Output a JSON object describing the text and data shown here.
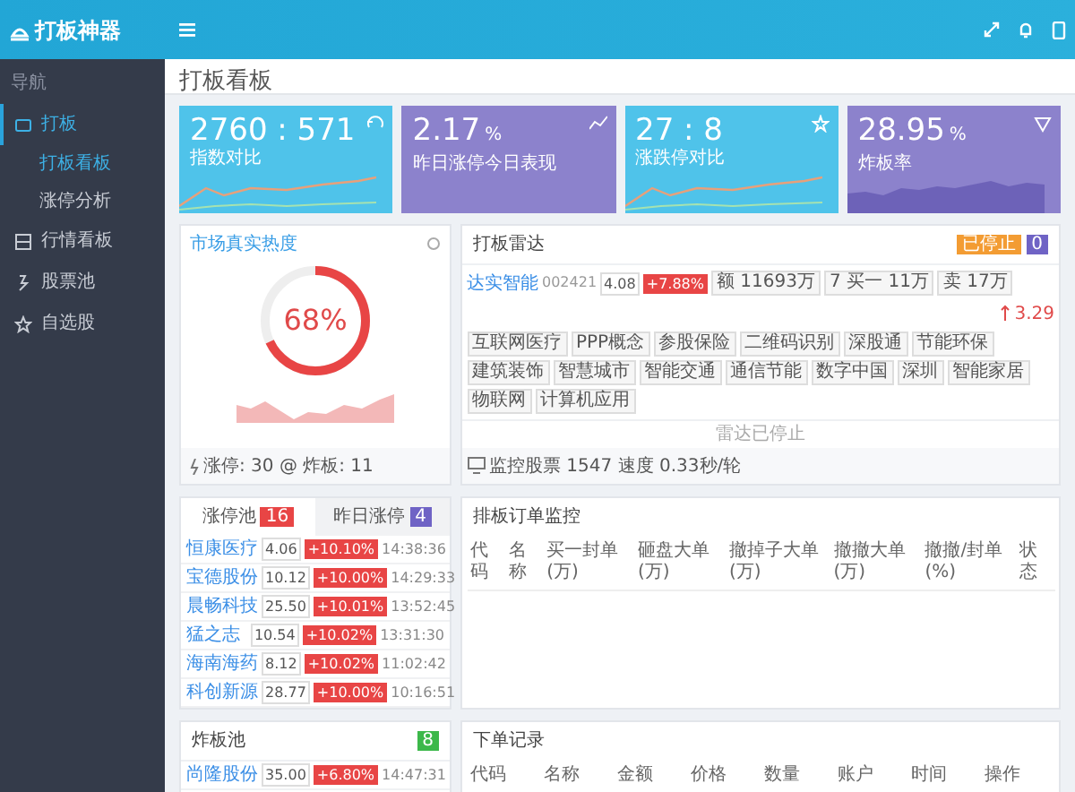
{
  "app": {
    "title": "打板神器"
  },
  "sidebar": {
    "heading": "导航",
    "items": [
      {
        "label": "打板",
        "selected": true,
        "children": [
          {
            "label": "打板看板",
            "selected": true
          },
          {
            "label": "涨停分析",
            "selected": false
          }
        ]
      },
      {
        "label": "行情看板",
        "selected": false
      },
      {
        "label": "股票池",
        "selected": false
      },
      {
        "label": "自选股",
        "selected": false
      }
    ]
  },
  "page_title": "打板看板",
  "stats": [
    {
      "value": "2760 : 571",
      "label": "指数对比",
      "color": "#4fc3ea",
      "kind": "line"
    },
    {
      "value": "2.17",
      "unit": "%",
      "label": "昨日涨停今日表现",
      "color": "#8c82cc",
      "kind": "flat"
    },
    {
      "value": "27 : 8",
      "label": "涨跌停对比",
      "color": "#4fc3ea",
      "kind": "line"
    },
    {
      "value": "28.95",
      "unit": "%",
      "label": "炸板率",
      "color": "#8c82cc",
      "kind": "area"
    }
  ],
  "heat": {
    "title": "市场真实热度",
    "reading": "68%",
    "level": 0.68,
    "footer": "涨停: 30 @ 炸板: 11"
  },
  "radar": {
    "title": "打板雷达",
    "badges": [
      {
        "text": "已停止",
        "color": "#f39c33"
      },
      {
        "text": "0",
        "color": "#6f63c5"
      }
    ],
    "stock": {
      "name": "达实智能",
      "code": "002421",
      "price": "4.08",
      "change": "+7.88%",
      "amount": "额 11693万",
      "buy": "7 买一 11万",
      "sell": "卖 17万",
      "score": "3.29"
    },
    "tags": [
      "互联网医疗",
      "PPP概念",
      "参股保险",
      "二维码识别",
      "深股通",
      "节能环保",
      "建筑装饰",
      "智慧城市",
      "智能交通",
      "通信节能",
      "数字中国",
      "深圳",
      "智能家居",
      "物联网",
      "计算机应用"
    ],
    "message": "雷达已停止",
    "footer": "监控股票 1547  速度 0.33秒/轮"
  },
  "pool": {
    "tabs": [
      {
        "label": "涨停池",
        "count": "16",
        "color": "#e84545",
        "selected": true
      },
      {
        "label": "昨日涨停",
        "count": "4",
        "color": "#6f63c5",
        "selected": false
      }
    ],
    "rows": [
      {
        "name": "恒康医疗",
        "price": "4.06",
        "change": "+10.10%",
        "time": "14:38:36"
      },
      {
        "name": "宝德股份",
        "price": "10.12",
        "change": "+10.00%",
        "time": "14:29:33"
      },
      {
        "name": "晨畅科技",
        "price": "25.50",
        "change": "+10.01%",
        "time": "13:52:45"
      },
      {
        "name": "猛之志",
        "price": "10.54",
        "change": "+10.02%",
        "time": "13:31:30"
      },
      {
        "name": "海南海药",
        "price": "8.12",
        "change": "+10.02%",
        "time": "11:02:42"
      },
      {
        "name": "科创新源",
        "price": "28.77",
        "change": "+10.00%",
        "time": "10:16:51"
      }
    ]
  },
  "orders": {
    "title": "排板订单监控",
    "columns": [
      "代码",
      "名称",
      "买一封单(万)",
      "砸盘大单(万)",
      "撤掉子大单(万)",
      "撤撤大单(万)",
      "撤撤/封单(%)",
      "状态"
    ]
  },
  "broken": {
    "title": "炸板池",
    "count": "8",
    "rows": [
      {
        "name": "尚隆股份",
        "price": "35.00",
        "change": "+6.80%",
        "time": "14:47:31"
      }
    ]
  },
  "records": {
    "title": "下单记录",
    "columns": [
      "代码",
      "名称",
      "金额",
      "价格",
      "数量",
      "账户",
      "时间",
      "操作"
    ]
  }
}
